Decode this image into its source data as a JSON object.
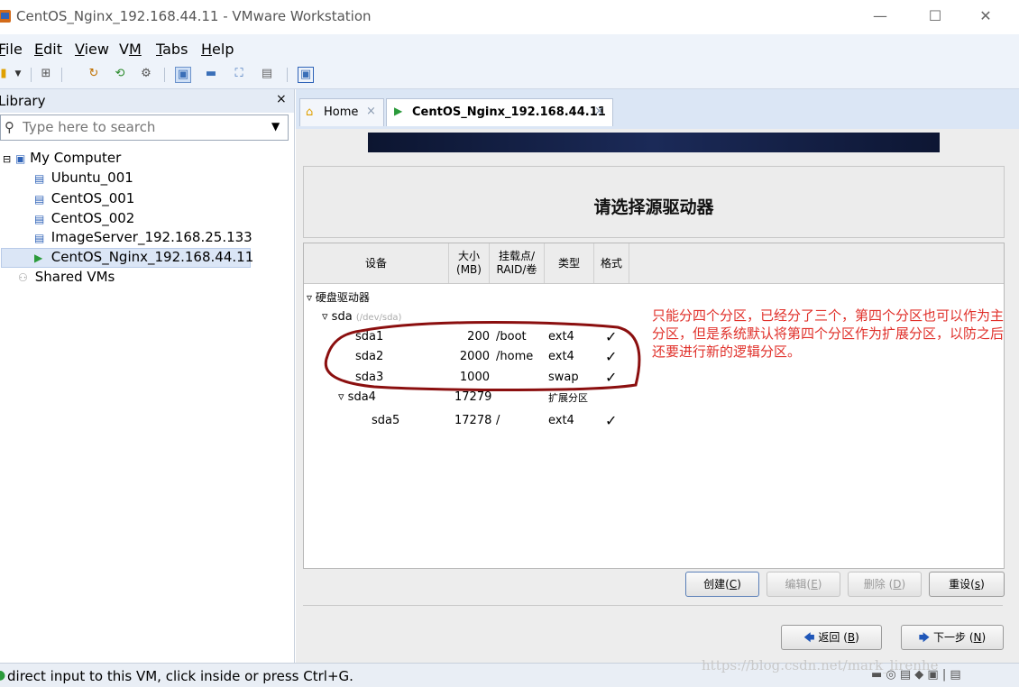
{
  "window": {
    "title": "CentOS_Nginx_192.168.44.11 - VMware Workstation",
    "minimize": "—",
    "maximize": "☐",
    "close": "✕"
  },
  "menu": {
    "file": {
      "prefix": "",
      "underlined": "F",
      "rest": "ile"
    },
    "edit": {
      "prefix": "",
      "underlined": "E",
      "rest": "dit"
    },
    "view": {
      "prefix": "",
      "underlined": "V",
      "rest": "iew"
    },
    "vm": {
      "prefix": "V",
      "underlined": "M",
      "rest": ""
    },
    "tabs": {
      "prefix": "",
      "underlined": "T",
      "rest": "abs"
    },
    "help": {
      "prefix": "",
      "underlined": "H",
      "rest": "elp"
    }
  },
  "library": {
    "title": "Library",
    "close": "×",
    "search_placeholder": "Type here to search",
    "tree": {
      "root": "My Computer",
      "vms": [
        "Ubuntu_001",
        "CentOS_001",
        "CentOS_002",
        "ImageServer_192.168.25.133",
        "CentOS_Nginx_192.168.44.11"
      ],
      "shared": "Shared VMs"
    }
  },
  "tabs": [
    {
      "label": "Home",
      "close": "×"
    },
    {
      "label": "CentOS_Nginx_192.168.44.11",
      "close": "×"
    }
  ],
  "installer": {
    "heading": "请选择源驱动器",
    "columns": {
      "device": "设备",
      "size_line1": "大小",
      "size_line2": "(MB)",
      "mount_line1": "挂载点/",
      "mount_line2": "RAID/卷",
      "type": "类型",
      "format": "格式"
    },
    "group": "硬盘驱动器",
    "disk": {
      "name": "sda",
      "path": "(/dev/sda)"
    },
    "partitions": [
      {
        "device": "sda1",
        "size": "200",
        "mount": "/boot",
        "type": "ext4",
        "format": "✓"
      },
      {
        "device": "sda2",
        "size": "2000",
        "mount": "/home",
        "type": "ext4",
        "format": "✓"
      },
      {
        "device": "sda3",
        "size": "1000",
        "mount": "",
        "type": "swap",
        "format": "✓"
      },
      {
        "device": "sda4",
        "size": "17279",
        "mount": "",
        "type": "扩展分区",
        "format": ""
      },
      {
        "device": "sda5",
        "size": "17278",
        "mount": "/",
        "type": "ext4",
        "format": "✓"
      }
    ],
    "buttons": {
      "create": {
        "label": "创建(",
        "key": "C",
        "end": ")"
      },
      "edit": {
        "label": "编辑(",
        "key": "E",
        "end": ")"
      },
      "delete": {
        "label": "删除 (",
        "key": "D",
        "end": ")"
      },
      "reset": {
        "label": "重设(",
        "key": "s",
        "end": ")"
      },
      "back": {
        "label": "返回 (",
        "key": "B",
        "end": ")"
      },
      "next": {
        "label": "下一步 (",
        "key": "N",
        "end": ")"
      }
    },
    "annotation": "只能分四个分区，已经分了三个，第四个分区也可以作为主分区，但是系统默认将第四个分区作为扩展分区，以防之后还要进行新的逻辑分区。"
  },
  "status": {
    "message": "direct input to this VM, click inside or press Ctrl+G."
  },
  "watermark": "https://blog.csdn.net/mark_lirenhe",
  "colors": {
    "annotation": "#e0302a",
    "circle": "#8b0f0f",
    "selection": "#dbe6f6"
  }
}
